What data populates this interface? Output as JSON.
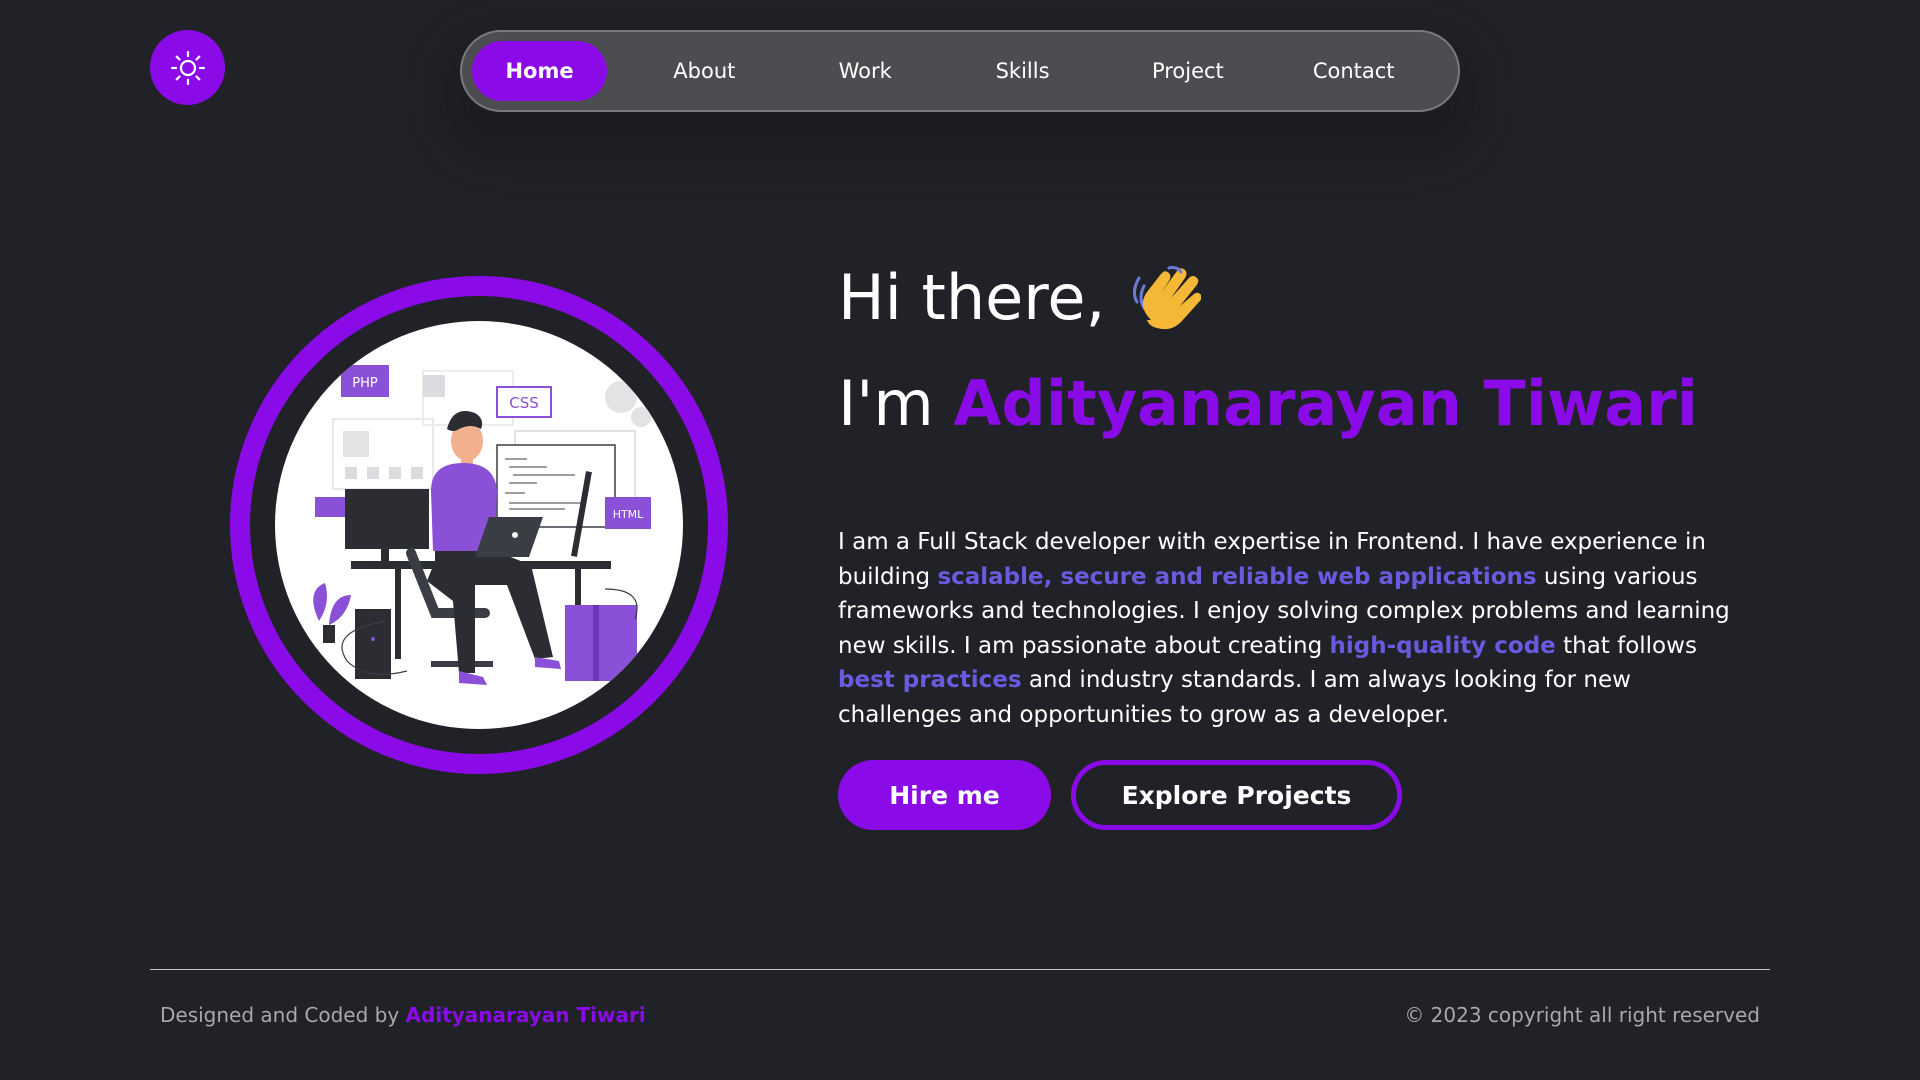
{
  "nav": {
    "items": [
      {
        "label": "Home",
        "active": true
      },
      {
        "label": "About"
      },
      {
        "label": "Work"
      },
      {
        "label": "Skills"
      },
      {
        "label": "Project"
      },
      {
        "label": "Contact"
      }
    ],
    "theme_toggle_icon": "sun-icon"
  },
  "hero": {
    "greeting": "Hi there,",
    "greeting_icon": "waving-hand-icon",
    "intro_prefix": "I'm",
    "name": "Adityanarayan Tiwari",
    "bio": {
      "part1": "I am a Full Stack developer with expertise in Frontend. I have experience in building ",
      "highlight1": "scalable, secure and reliable web applications",
      "part2": " using various frameworks and technologies. I enjoy solving complex problems and learning new skills. I am passionate about creating ",
      "highlight2": "high-quality code",
      "part3": " that follows ",
      "highlight3": "best practices",
      "part4": " and industry standards. I am always looking for new challenges and opportunities to grow as a developer."
    },
    "illustration": {
      "badges": [
        "PHP",
        "CSS",
        "HTML"
      ]
    },
    "buttons": {
      "hire": "Hire me",
      "explore": "Explore Projects"
    }
  },
  "footer": {
    "credit_prefix": "Designed and Coded by ",
    "credit_name": "Adityanarayan Tiwari",
    "copyright": "© 2023 copyright all right reserved"
  },
  "colors": {
    "background": "#202227",
    "accent": "#8a0be8",
    "highlight": "#6b5ae0",
    "nav_bg": "#4b4d50"
  }
}
